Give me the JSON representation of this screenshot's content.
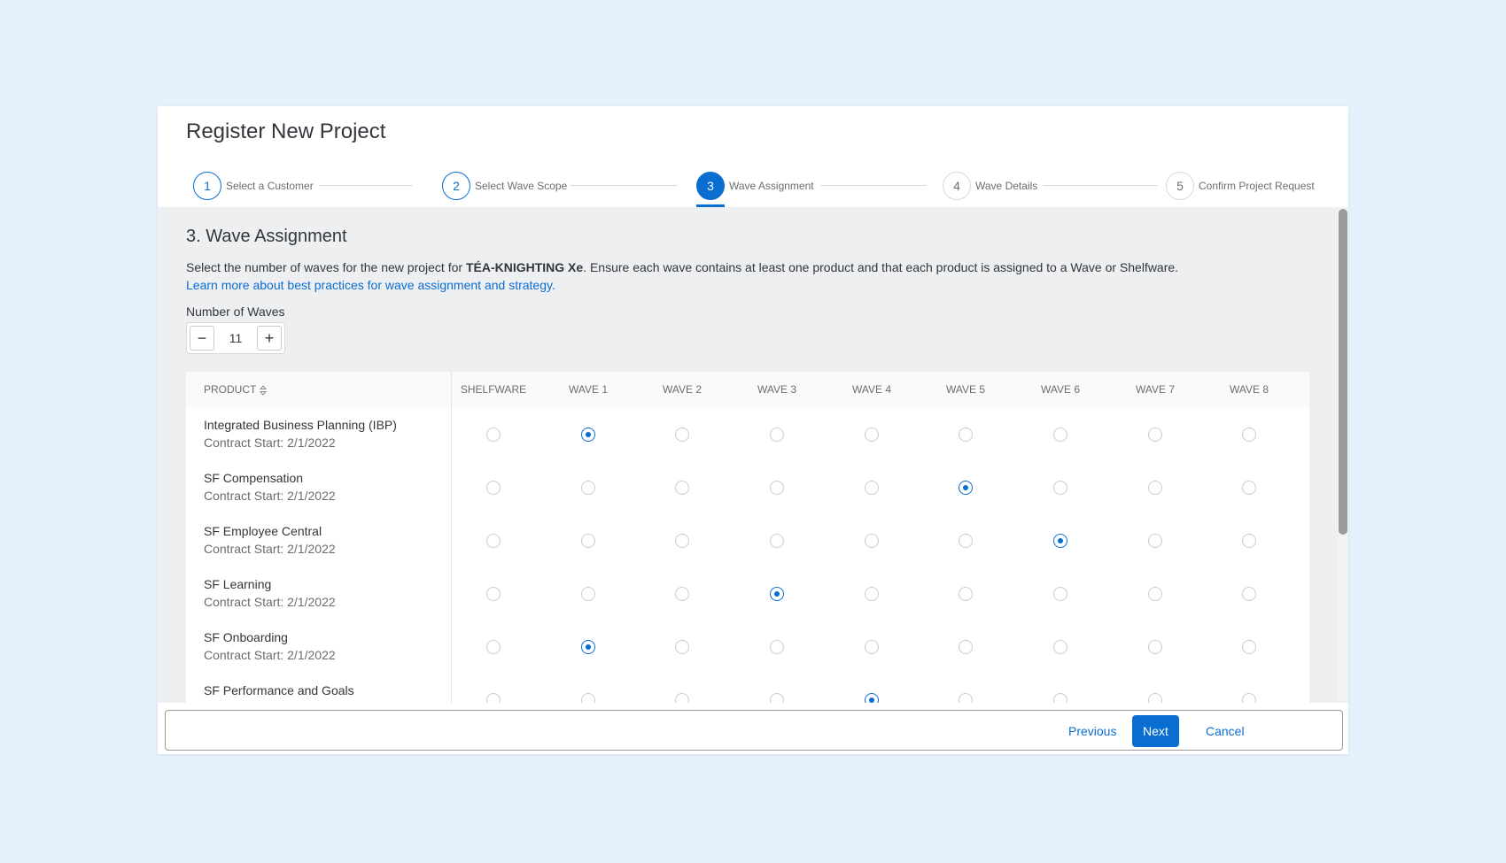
{
  "dialog": {
    "title": "Register New Project"
  },
  "steps": [
    {
      "number": "1",
      "label": "Select a Customer",
      "state": "done"
    },
    {
      "number": "2",
      "label": "Select Wave Scope",
      "state": "done"
    },
    {
      "number": "3",
      "label": "Wave Assignment",
      "state": "active"
    },
    {
      "number": "4",
      "label": "Wave Details",
      "state": "pending"
    },
    {
      "number": "5",
      "label": "Confirm Project Request",
      "state": "pending"
    }
  ],
  "section": {
    "title": "3. Wave Assignment",
    "desc_before": "Select the number of waves for the new project for ",
    "customer": "TÉA-KNIGHTING Xe",
    "desc_after": ". Ensure each wave contains at least one product and that each product is assigned to a Wave or Shelfware.",
    "link": "Learn more about best practices for wave assignment and strategy."
  },
  "waves_input": {
    "label": "Number of Waves",
    "value": "11",
    "minus": "−",
    "plus": "+"
  },
  "table": {
    "product_header": "PRODUCT",
    "columns": [
      "SHELFWARE",
      "WAVE 1",
      "WAVE 2",
      "WAVE 3",
      "WAVE 4",
      "WAVE 5",
      "WAVE 6",
      "WAVE 7",
      "WAVE 8"
    ],
    "rows": [
      {
        "name": "Integrated Business Planning (IBP)",
        "sub": "Contract Start: 2/1/2022",
        "selected": 1
      },
      {
        "name": "SF Compensation",
        "sub": "Contract Start: 2/1/2022",
        "selected": 5
      },
      {
        "name": "SF Employee Central",
        "sub": "Contract Start: 2/1/2022",
        "selected": 6
      },
      {
        "name": "SF Learning",
        "sub": "Contract Start: 2/1/2022",
        "selected": 3
      },
      {
        "name": "SF Onboarding",
        "sub": "Contract Start: 2/1/2022",
        "selected": 1
      },
      {
        "name": "SF Performance and Goals",
        "sub": "",
        "selected": 4
      }
    ]
  },
  "footer": {
    "previous": "Previous",
    "next": "Next",
    "cancel": "Cancel"
  },
  "colors": {
    "accent": "#0a6ed1",
    "page_bg": "#e5f1fc",
    "content_bg": "#edeff0"
  }
}
